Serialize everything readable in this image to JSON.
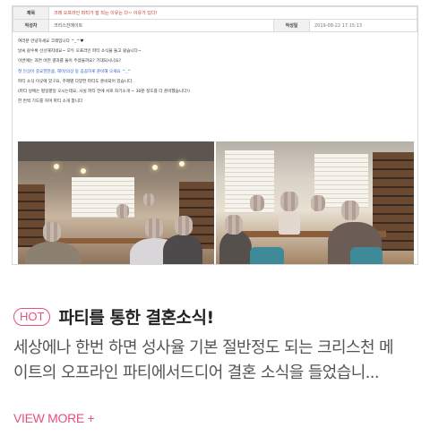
{
  "post": {
    "subject_label": "제목",
    "subject_value": "크레 오프라인 파티가 잘 되는 이유는 다~ 이유가 있다!",
    "author_label": "작성자",
    "author_value": "크리스천메이트",
    "date_label": "작성일",
    "date_value": "2019-08-22 17:15:13",
    "body": [
      "여러분 안녕하세요 크레입니다 ^_^♥",
      "날씨 갈수록 선선해지네요~ 모두 오프라인 파티 소식을 들고 왔습니다~",
      "이번에는 과연 어떤 결과를 들어 주셨을까요? 기대되시나요?",
      "첫 인상이 중요한만큼, 헤어/의상 등 꼼꼼하게 준비해 오세요 ^_^",
      "파티 소식 이곳에 있구요, 주제별 다양한 파티도 준비되어 있습니다.",
      "(파티 날에는 평일평일 오시는데요, 사실 파티 전에 서로 자기소개 ~ 30분 정도를 더 준비했습니다!)",
      "한 번씩 기도를 하며 파티 소개 합니다"
    ]
  },
  "badge": "HOT",
  "title": "파티를 통한 결혼소식!",
  "excerpt_lines": [
    "세상에나 한번 하면 성사율 기본 절반정도 되는 크리스천 메",
    "이트의 오프라인 파티에서드디어 결혼 소식을 들었습니..."
  ],
  "view_more": "VIEW MORE +"
}
